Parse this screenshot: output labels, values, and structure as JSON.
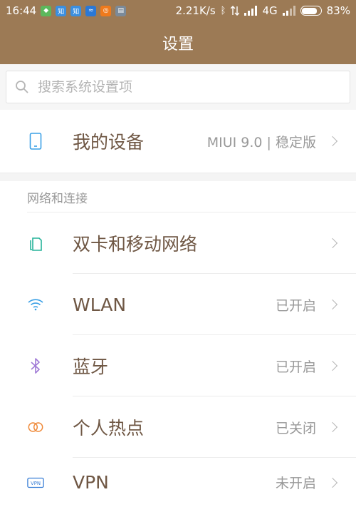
{
  "status_bar": {
    "time": "16:44",
    "network_speed": "2.21K/s",
    "network_type": "4G",
    "battery_percent": "83%",
    "battery_level": 0.83,
    "notification_icons": [
      {
        "name": "shield-app-icon",
        "color": "#5cb85c",
        "glyph": "◆"
      },
      {
        "name": "zhihu-app-icon",
        "color": "#3b8fe0",
        "glyph": "知"
      },
      {
        "name": "zhihu-app-icon-2",
        "color": "#3b8fe0",
        "glyph": "知"
      },
      {
        "name": "sync-app-icon",
        "color": "#2a78d6",
        "glyph": "≈"
      },
      {
        "name": "weibo-app-icon",
        "color": "#ef7a1c",
        "glyph": "◎"
      },
      {
        "name": "message-app-icon",
        "color": "#7b8a99",
        "glyph": "▤"
      }
    ]
  },
  "title": "设置",
  "search": {
    "placeholder": "搜索系统设置项"
  },
  "my_device": {
    "label": "我的设备",
    "value": "MIUI 9.0 | 稳定版"
  },
  "network_section": {
    "header": "网络和连接",
    "items": [
      {
        "label": "双卡和移动网络",
        "value": "",
        "icon": "dual-sim-icon"
      },
      {
        "label": "WLAN",
        "value": "已开启",
        "icon": "wifi-icon"
      },
      {
        "label": "蓝牙",
        "value": "已开启",
        "icon": "bluetooth-icon"
      },
      {
        "label": "个人热点",
        "value": "已关闭",
        "icon": "hotspot-icon"
      },
      {
        "label": "VPN",
        "value": "未开启",
        "icon": "vpn-icon"
      }
    ]
  },
  "colors": {
    "header_bg": "#9c7a55",
    "label_text": "#6f5744",
    "value_text": "#999999"
  }
}
